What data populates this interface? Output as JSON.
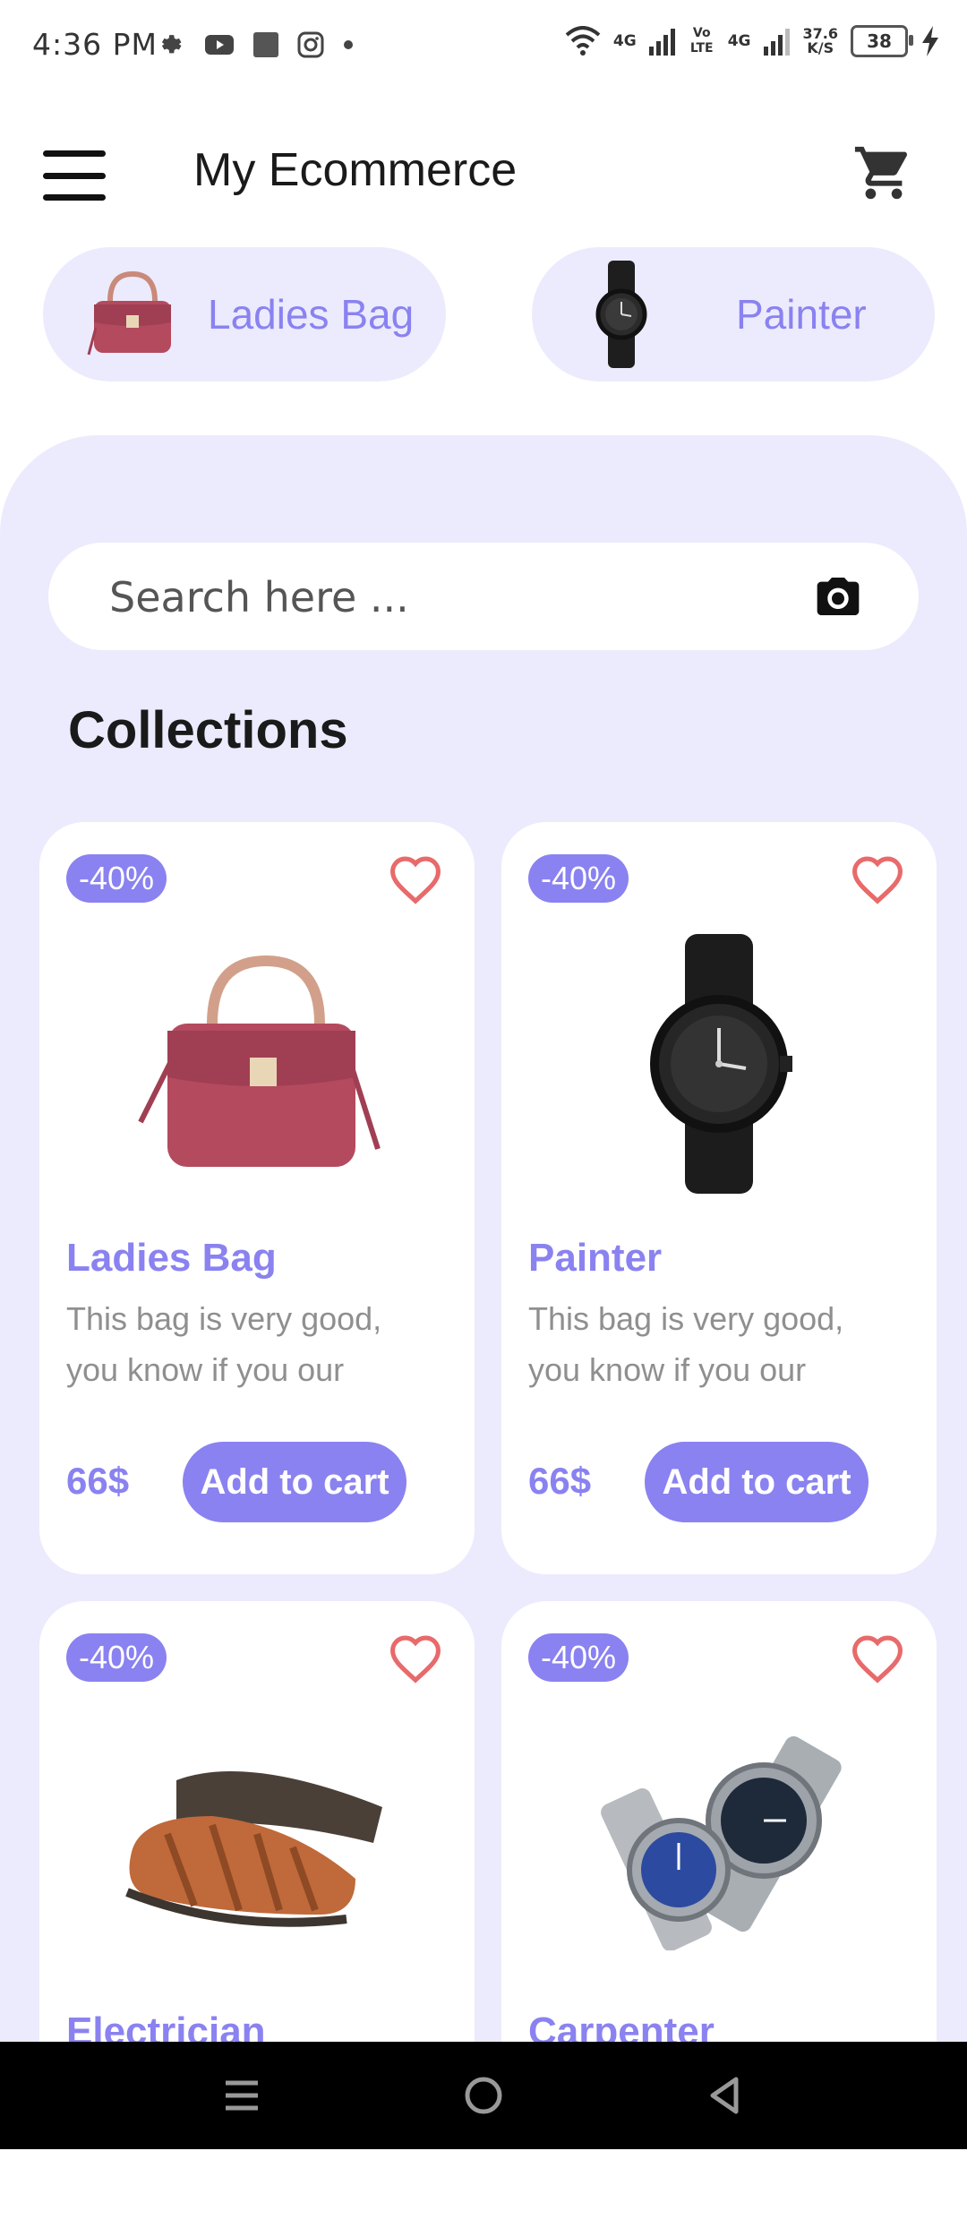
{
  "status_bar": {
    "time": "4:36 PM",
    "network_1": "4G",
    "volte": "Vo LTE",
    "network_2": "4G",
    "speed": "37.6",
    "speed_unit": "K/S",
    "battery": "38"
  },
  "app_bar": {
    "title": "My Ecommerce",
    "menu_icon": "hamburger-icon",
    "cart_icon": "shopping-cart-icon"
  },
  "categories": [
    {
      "label": "Ladies Bag",
      "icon": "handbag-image"
    },
    {
      "label": "Painter",
      "icon": "watch-image"
    }
  ],
  "search": {
    "placeholder": "Search here ...",
    "icon": "camera-icon"
  },
  "section_title": "Collections",
  "products": [
    {
      "badge": "-40%",
      "name": "Ladies Bag",
      "description": "This bag is very good, you know if you our",
      "price": "66$",
      "button": "Add to cart",
      "image": "handbag-image"
    },
    {
      "badge": "-40%",
      "name": "Painter",
      "description": "This bag is very good, you know if you our",
      "price": "66$",
      "button": "Add to cart",
      "image": "watch-image"
    },
    {
      "badge": "-40%",
      "name": "Electrician",
      "image": "sandals-image"
    },
    {
      "badge": "-40%",
      "name": "Carpenter",
      "image": "watches-pair-image"
    }
  ],
  "colors": {
    "accent": "#8a82f0",
    "panel_bg": "#ecebfd",
    "heart": "#e86a6a"
  }
}
